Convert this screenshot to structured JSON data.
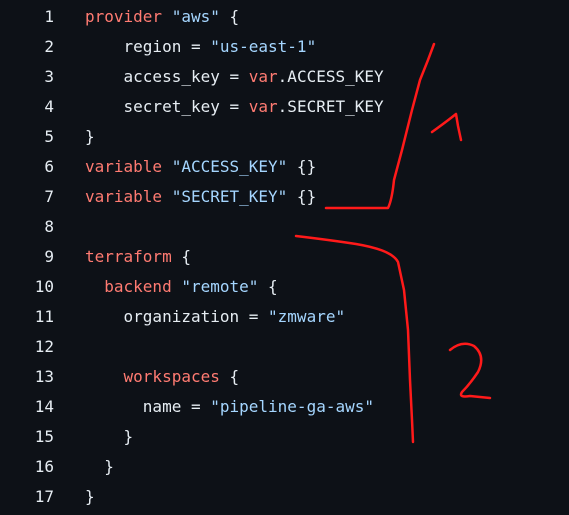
{
  "lines": [
    {
      "num": "1",
      "tokens": [
        {
          "t": "provider ",
          "c": "kw"
        },
        {
          "t": "\"aws\"",
          "c": "str"
        },
        {
          "t": " {",
          "c": "plain"
        }
      ]
    },
    {
      "num": "2",
      "tokens": [
        {
          "t": "    region = ",
          "c": "plain"
        },
        {
          "t": "\"us-east-1\"",
          "c": "str"
        }
      ]
    },
    {
      "num": "3",
      "tokens": [
        {
          "t": "    access_key = ",
          "c": "plain"
        },
        {
          "t": "var",
          "c": "kw"
        },
        {
          "t": ".ACCESS_KEY",
          "c": "plain"
        }
      ]
    },
    {
      "num": "4",
      "tokens": [
        {
          "t": "    secret_key = ",
          "c": "plain"
        },
        {
          "t": "var",
          "c": "kw"
        },
        {
          "t": ".SECRET_KEY",
          "c": "plain"
        }
      ]
    },
    {
      "num": "5",
      "tokens": [
        {
          "t": "}",
          "c": "plain"
        }
      ]
    },
    {
      "num": "6",
      "tokens": [
        {
          "t": "variable ",
          "c": "kw"
        },
        {
          "t": "\"ACCESS_KEY\"",
          "c": "str"
        },
        {
          "t": " {}",
          "c": "plain"
        }
      ]
    },
    {
      "num": "7",
      "tokens": [
        {
          "t": "variable ",
          "c": "kw"
        },
        {
          "t": "\"SECRET_KEY\"",
          "c": "str"
        },
        {
          "t": " {}",
          "c": "plain"
        }
      ]
    },
    {
      "num": "8",
      "tokens": []
    },
    {
      "num": "9",
      "tokens": [
        {
          "t": "terraform",
          "c": "kw"
        },
        {
          "t": " {",
          "c": "plain"
        }
      ]
    },
    {
      "num": "10",
      "tokens": [
        {
          "t": "  backend ",
          "c": "kw"
        },
        {
          "t": "\"remote\"",
          "c": "str"
        },
        {
          "t": " {",
          "c": "plain"
        }
      ]
    },
    {
      "num": "11",
      "tokens": [
        {
          "t": "    organization = ",
          "c": "plain"
        },
        {
          "t": "\"zmware\"",
          "c": "str"
        }
      ]
    },
    {
      "num": "12",
      "tokens": []
    },
    {
      "num": "13",
      "tokens": [
        {
          "t": "    workspaces",
          "c": "kw"
        },
        {
          "t": " {",
          "c": "plain"
        }
      ]
    },
    {
      "num": "14",
      "tokens": [
        {
          "t": "      name = ",
          "c": "plain"
        },
        {
          "t": "\"pipeline-ga-aws\"",
          "c": "str"
        }
      ]
    },
    {
      "num": "15",
      "tokens": [
        {
          "t": "    }",
          "c": "plain"
        }
      ]
    },
    {
      "num": "16",
      "tokens": [
        {
          "t": "  }",
          "c": "plain"
        }
      ]
    },
    {
      "num": "17",
      "tokens": [
        {
          "t": "}",
          "c": "plain"
        }
      ]
    }
  ],
  "annotations": {
    "label_1": "1",
    "label_2": "2",
    "color": "#ff1a1a"
  },
  "colors": {
    "background": "#0d1117",
    "keyword": "#ff7b72",
    "string": "#a5d6ff",
    "text": "#e6edf3"
  }
}
